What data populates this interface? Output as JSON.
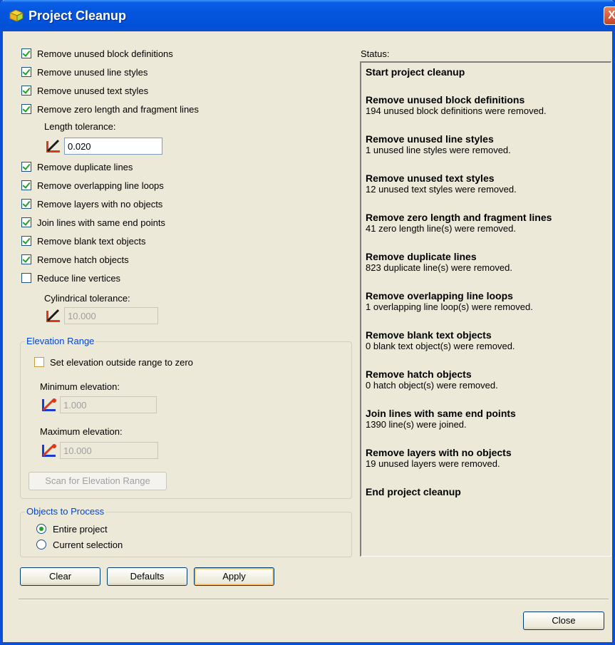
{
  "window": {
    "title": "Project Cleanup",
    "close_glyph": "X"
  },
  "options": [
    {
      "label": "Remove unused block definitions",
      "checked": true
    },
    {
      "label": "Remove unused line styles",
      "checked": true
    },
    {
      "label": "Remove unused text styles",
      "checked": true
    },
    {
      "label": "Remove zero length and fragment lines",
      "checked": true
    },
    {
      "label": "Remove duplicate lines",
      "checked": true
    },
    {
      "label": "Remove overlapping line loops",
      "checked": true
    },
    {
      "label": "Remove layers with no objects",
      "checked": true
    },
    {
      "label": "Join lines with same end points",
      "checked": true
    },
    {
      "label": "Remove blank text objects",
      "checked": true
    },
    {
      "label": "Remove hatch objects",
      "checked": true
    },
    {
      "label": "Reduce line vertices",
      "checked": false
    }
  ],
  "length_tolerance": {
    "label": "Length tolerance:",
    "value": "0.020",
    "enabled": true
  },
  "cylindrical_tolerance": {
    "label": "Cylindrical tolerance:",
    "value": "10.000",
    "enabled": false
  },
  "elevation_range": {
    "title": "Elevation Range",
    "set_zero_label": "Set elevation outside range to zero",
    "set_zero_checked": false,
    "min_label": "Minimum elevation:",
    "min_value": "1.000",
    "max_label": "Maximum elevation:",
    "max_value": "10.000",
    "scan_button": "Scan for Elevation Range"
  },
  "objects_to_process": {
    "title": "Objects to Process",
    "options": [
      {
        "label": "Entire project",
        "selected": true
      },
      {
        "label": "Current selection",
        "selected": false
      }
    ]
  },
  "buttons": {
    "clear": "Clear",
    "defaults": "Defaults",
    "apply": "Apply",
    "close": "Close"
  },
  "status": {
    "label": "Status:",
    "entries": [
      {
        "heading": "Start project cleanup",
        "detail": ""
      },
      {
        "heading": "Remove unused block definitions",
        "detail": "194 unused block definitions were removed."
      },
      {
        "heading": "Remove unused line styles",
        "detail": "1 unused line styles were removed."
      },
      {
        "heading": "Remove unused text styles",
        "detail": "12 unused text styles were removed."
      },
      {
        "heading": "Remove zero length and fragment lines",
        "detail": "41 zero length line(s) were removed."
      },
      {
        "heading": "Remove duplicate lines",
        "detail": "823 duplicate line(s) were removed."
      },
      {
        "heading": "Remove overlapping line loops",
        "detail": "1 overlapping line loop(s) were removed."
      },
      {
        "heading": "Remove blank text objects",
        "detail": "0 blank text object(s) were removed."
      },
      {
        "heading": "Remove hatch objects",
        "detail": "0 hatch object(s) were removed."
      },
      {
        "heading": "Join lines with same end points",
        "detail": "1390 line(s) were joined."
      },
      {
        "heading": "Remove layers with no objects",
        "detail": "19 unused layers were removed."
      },
      {
        "heading": "End project cleanup",
        "detail": ""
      }
    ]
  },
  "colors": {
    "titlebar": "#0455dd",
    "group_title": "#0046d5",
    "check": "#21a121"
  }
}
